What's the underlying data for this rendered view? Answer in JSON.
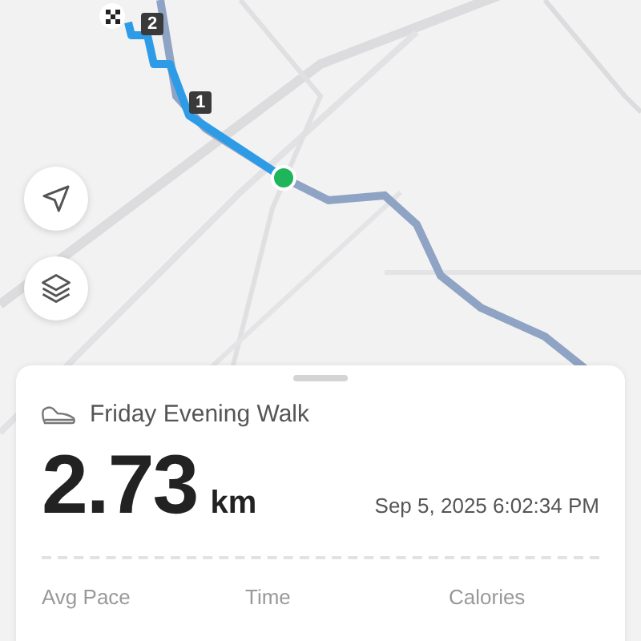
{
  "map": {
    "kind": "picture",
    "markers": [
      {
        "label": "2"
      },
      {
        "label": "1"
      }
    ]
  },
  "activity": {
    "title": "Friday Evening Walk",
    "distance": "2.73",
    "unit": "km",
    "date": "Sep 5, 2025 6:02:34 PM",
    "stats": [
      {
        "label": "Avg Pace"
      },
      {
        "label": "Time"
      },
      {
        "label": "Calories"
      }
    ]
  }
}
